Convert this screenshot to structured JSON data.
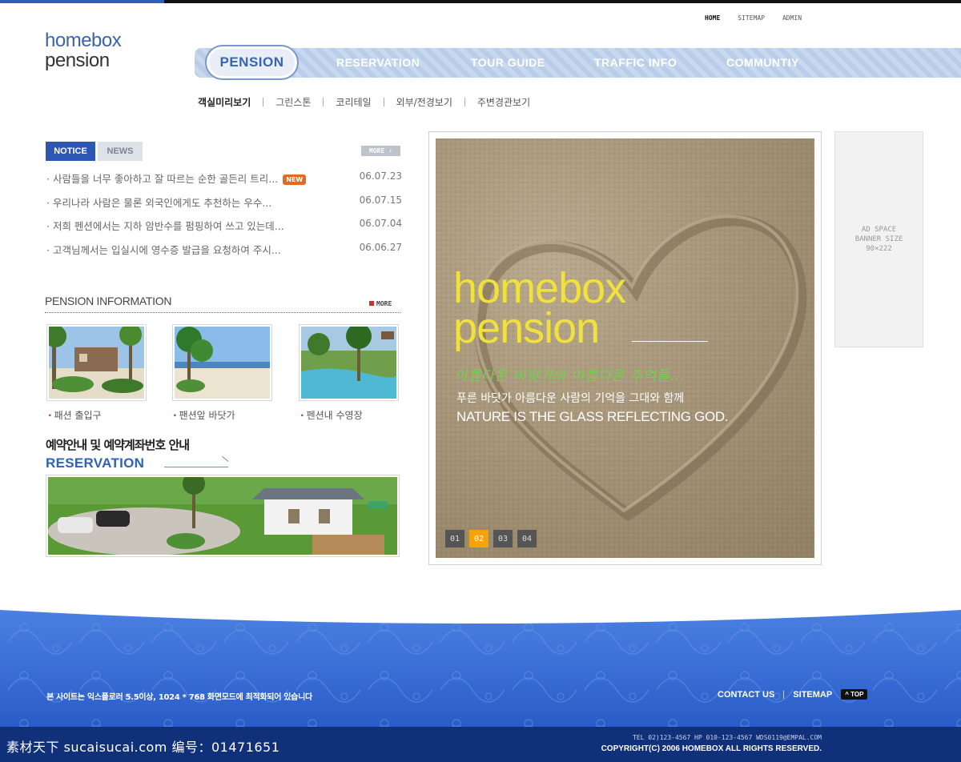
{
  "logo": {
    "line1": "homebox",
    "line2": "pension"
  },
  "util_nav": [
    "HOME",
    "SITEMAP",
    "ADMIN"
  ],
  "gnb": {
    "active": "PENSION",
    "items": [
      "RESERVATION",
      "TOUR GUIDE",
      "TRAFFIC INFO",
      "COMMUNTIY"
    ]
  },
  "subnav": [
    "객실미리보기",
    "그린스톤",
    "코리테일",
    "외부/전경보기",
    "주변경관보기"
  ],
  "notice": {
    "tabs": [
      "NOTICE",
      "NEWS"
    ],
    "more": "MORE",
    "new_badge": "NEW",
    "items": [
      {
        "title": "· 사람들을 너무 좋아하고 잘 따르는 순한 골든리 트리...",
        "date": "06.07.23"
      },
      {
        "title": "· 우리나라 사람은 물론 외국인에게도 추천하는 우수...",
        "date": "06.07.15"
      },
      {
        "title": "· 저희 펜션에서는 지하 암반수를 펌핑하여 쓰고 있는데...",
        "date": "06.07.04"
      },
      {
        "title": "· 고객님께서는 입실시에 영수증 발급을 요청하여 주시...",
        "date": "06.06.27"
      }
    ]
  },
  "pension_info": {
    "title": "PENSION INFORMATION",
    "more": "MORE",
    "thumbs": [
      "패션 출입구",
      "팬션앞 바닷가",
      "펜션내 수영장"
    ]
  },
  "reservation": {
    "title_ko": "예약안내 및 예약계좌번호 안내",
    "title_en": "RESERVATION"
  },
  "main_visual": {
    "title1": "homebox",
    "title2": "pension",
    "script": "아름다운 바닷가와 아름다운 추억들...",
    "text_ko": "푸른 바닷가 아름다운 사람의 기억을 그대와 함께",
    "text_en": "NATURE IS THE GLASS REFLECTING GOD.",
    "pages": [
      "01",
      "02",
      "03",
      "04"
    ],
    "active_page": "02"
  },
  "ad": {
    "line1": "AD SPACE",
    "line2": "BANNER SIZE",
    "line3": "90×222"
  },
  "footer": {
    "notice": "본 사이트는 익스플로러 5.5이상, 1024 * 768 화면모드에 최적화되어 있습니다",
    "links": [
      "CONTACT US",
      "SITEMAP"
    ],
    "top": "TOP",
    "contact": "TEL 02)123-4567 HP 010-123-4567   WDS0119@EMPAL.COM",
    "copyright": "COPYRIGHT(C) 2006 HOMEBOX ALL RIGHTS RESERVED.",
    "watermark": "素材天下 sucaisucai.com  编号：01471651"
  },
  "colors": {
    "brand_blue": "#2e56b3",
    "accent_orange": "#f5a20b",
    "new_badge": "#e56a1e",
    "title_yellow": "#f0e23a"
  }
}
